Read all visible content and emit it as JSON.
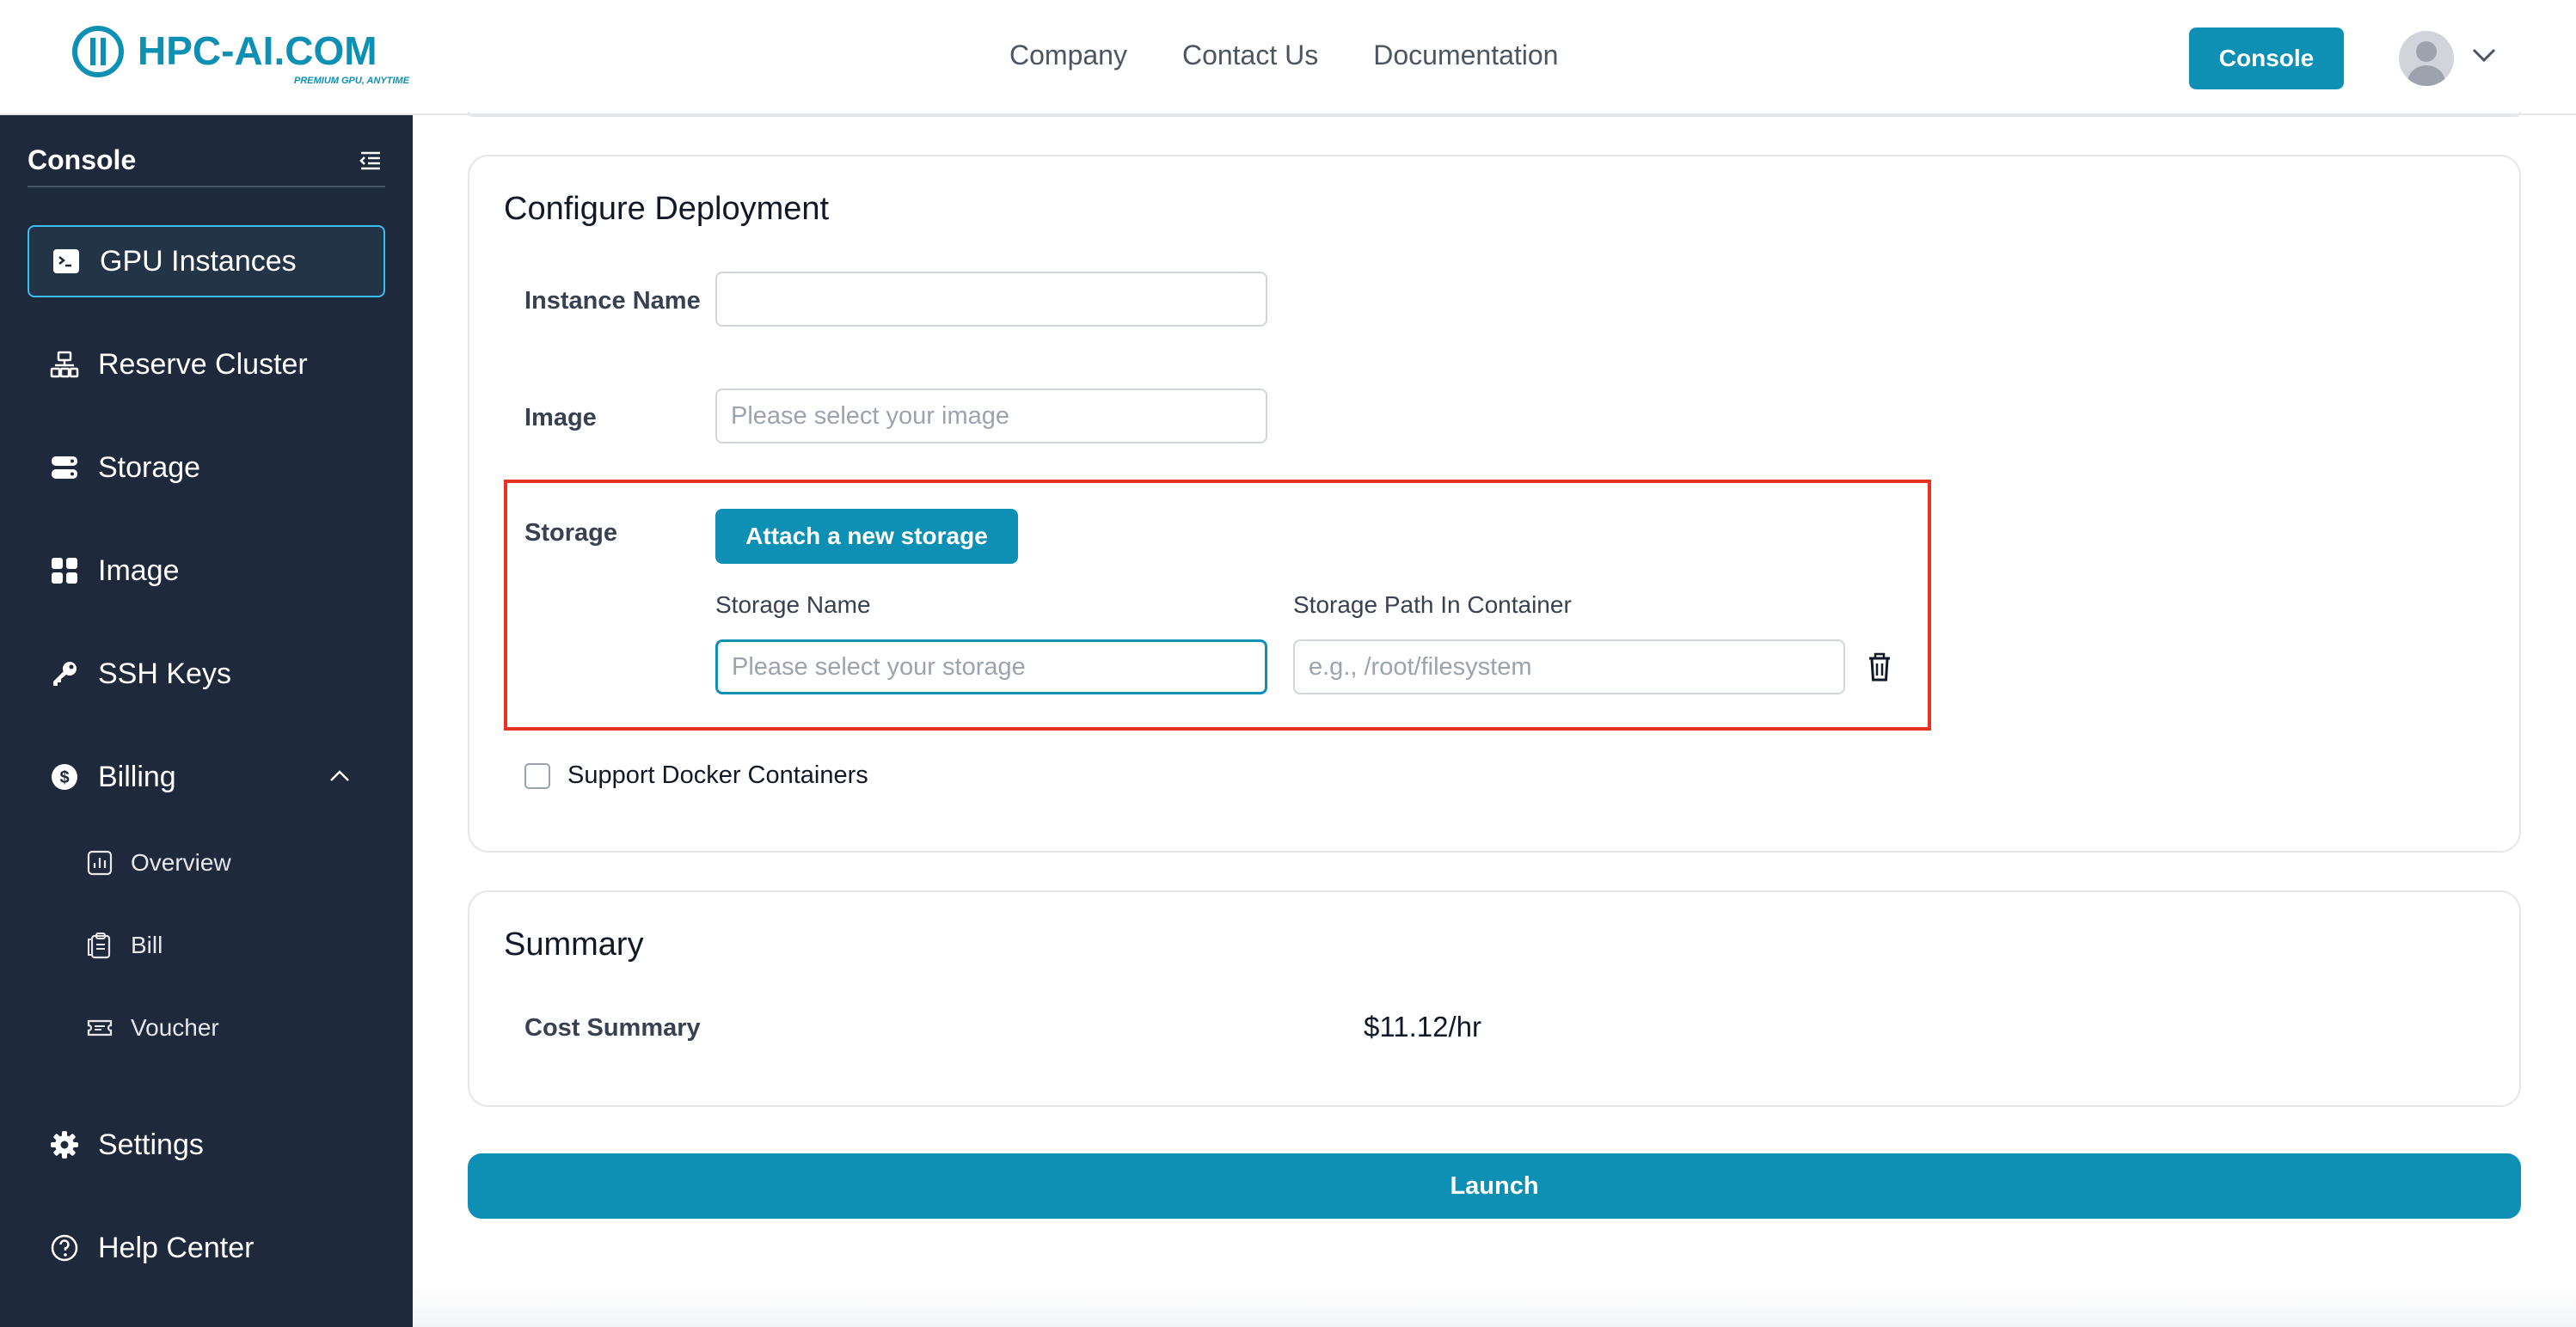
{
  "brand": {
    "logo_text": "HPC-AI.COM",
    "tagline": "PREMIUM GPU, ANYTIME",
    "accent_color": "#0e8fb4"
  },
  "topnav": {
    "links": [
      "Company",
      "Contact Us",
      "Documentation"
    ],
    "console_label": "Console",
    "avatar_icon": "user-avatar-icon",
    "menu_icon": "chevron-down-icon"
  },
  "sidebar": {
    "title": "Console",
    "collapse_icon": "collapse-menu-icon",
    "items": [
      {
        "label": "GPU Instances",
        "icon": "terminal-icon",
        "active": true
      },
      {
        "label": "Reserve Cluster",
        "icon": "cluster-icon"
      },
      {
        "label": "Storage",
        "icon": "storage-icon"
      },
      {
        "label": "Image",
        "icon": "grid-icon"
      },
      {
        "label": "SSH Keys",
        "icon": "key-icon"
      },
      {
        "label": "Billing",
        "icon": "dollar-icon",
        "expanded": true
      },
      {
        "label": "Settings",
        "icon": "gear-icon"
      },
      {
        "label": "Help Center",
        "icon": "help-icon"
      }
    ],
    "billing_sub": [
      {
        "label": "Overview",
        "icon": "chart-icon"
      },
      {
        "label": "Bill",
        "icon": "clipboard-icon"
      },
      {
        "label": "Voucher",
        "icon": "ticket-icon"
      }
    ]
  },
  "configure": {
    "title": "Configure Deployment",
    "instance_name_label": "Instance Name",
    "instance_name_value": "",
    "image_label": "Image",
    "image_placeholder": "Please select your image",
    "storage_label": "Storage",
    "attach_button": "Attach a new storage",
    "storage_name_label": "Storage Name",
    "storage_name_placeholder": "Please select your storage",
    "storage_path_label": "Storage Path In Container",
    "storage_path_placeholder": "e.g., /root/filesystem",
    "docker_label": "Support Docker Containers",
    "docker_checked": false
  },
  "summary": {
    "title": "Summary",
    "cost_label": "Cost Summary",
    "cost_value": "$11.12/hr"
  },
  "launch_label": "Launch"
}
